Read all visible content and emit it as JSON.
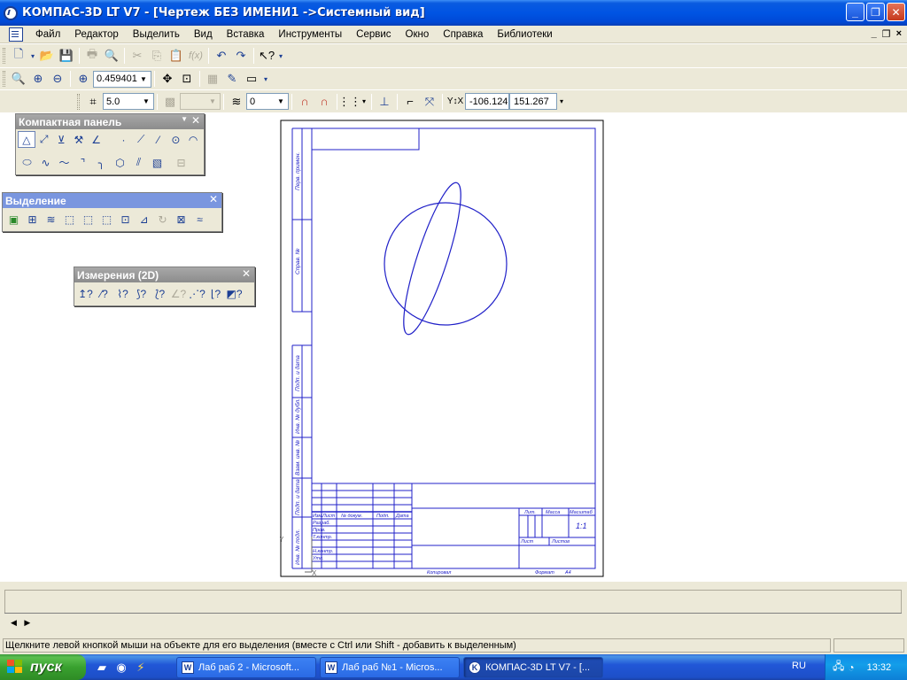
{
  "window": {
    "title": "КОМПАС-3D LT V7 - [Чертеж БЕЗ ИМЕНИ1 ->Системный вид]",
    "min_label": "_",
    "max_label": "❐",
    "close_label": "✕"
  },
  "menu": {
    "items": [
      "Файл",
      "Редактор",
      "Выделить",
      "Вид",
      "Вставка",
      "Инструменты",
      "Сервис",
      "Окно",
      "Справка",
      "Библиотеки"
    ],
    "mdi_min": "_",
    "mdi_restore": "❐",
    "mdi_close": "×"
  },
  "toolbar2": {
    "zoom_value": "0.459401"
  },
  "toolbar3": {
    "step_value": "5.0",
    "layer_value": "0",
    "coord_x": "-106.124",
    "coord_y": "151.267"
  },
  "panels": {
    "compact": {
      "title": "Компактная панель"
    },
    "selection": {
      "title": "Выделение"
    },
    "measure": {
      "title": "Измерения (2D)"
    }
  },
  "drawing": {
    "frame_labels": [
      "Перв. примен.",
      "Справ. №",
      "Подп. и дата",
      "Инв. № дубл.",
      "Взам. инв. №",
      "Подп. и дата",
      "Инв. № подл."
    ],
    "stamp_labels": {
      "izm": "Изм.",
      "list": "Лист",
      "ndoc": "№ докум.",
      "podp": "Подп.",
      "data": "Дата",
      "razrab": "Разраб.",
      "prov": "Пров.",
      "tkontr": "Т.контр.",
      "nkontr": "Н.контр.",
      "utv": "Утв.",
      "lit": "Лит.",
      "massa": "Масса",
      "masshtab": "Масштаб",
      "list2": "Лист",
      "listov": "Листов",
      "scale_value": "1:1",
      "kopiroval": "Копировал",
      "format": "Формат",
      "format_value": "A4"
    }
  },
  "status": {
    "hint": "Щелкните левой кнопкой мыши на объекте для его выделения (вместе с Ctrl или Shift - добавить к выделенным)",
    "scroll_arrows": "◀ ▶"
  },
  "taskbar": {
    "start_label": "пуск",
    "tasks": [
      "Лаб раб 2 - Microsoft...",
      "Лаб раб №1 - Micros...",
      "КОМПАС-3D LT V7 - [..."
    ],
    "lang": "RU",
    "clock": "13:32"
  }
}
